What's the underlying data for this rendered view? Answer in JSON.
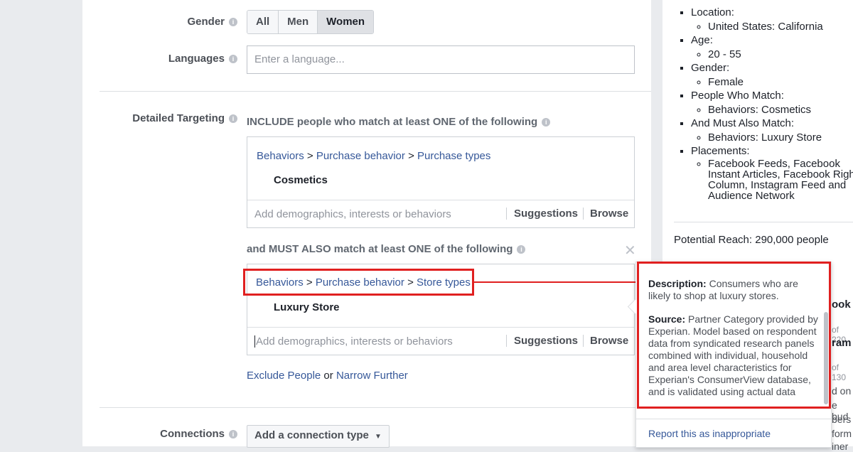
{
  "gender": {
    "label": "Gender",
    "options": [
      "All",
      "Men",
      "Women"
    ]
  },
  "languages": {
    "label": "Languages",
    "placeholder": "Enter a language..."
  },
  "detailed_targeting": {
    "label": "Detailed Targeting",
    "include_heading": "INCLUDE people who match at least ONE of the following",
    "include_crumbs": [
      "Behaviors",
      ">",
      "Purchase behavior",
      ">",
      "Purchase types"
    ],
    "include_item": "Cosmetics",
    "add_placeholder": "Add demographics, interests or behaviors",
    "suggestions": "Suggestions",
    "browse": "Browse",
    "must_heading": "and MUST ALSO match at least ONE of the following",
    "must_crumbs": [
      "Behaviors",
      ">",
      "Purchase behavior",
      ">",
      "Store types"
    ],
    "must_item": "Luxury Store",
    "exclude": "Exclude People",
    "or": "or",
    "narrow": "Narrow Further"
  },
  "connections": {
    "label": "Connections",
    "button": "Add a connection type"
  },
  "summary": {
    "location_label": "Location:",
    "location_value": "United States: California",
    "age_label": "Age:",
    "age_value": "20 - 55",
    "gender_label": "Gender:",
    "gender_value": "Female",
    "match_label": "People Who Match:",
    "match_value": "Behaviors: Cosmetics",
    "also_label": "And Must Also Match:",
    "also_value": "Behaviors: Luxury Store",
    "placements_label": "Placements:",
    "placements_value": "Facebook Feeds, Facebook Instant Articles, Facebook Right Column, Instagram Feed and Audience Network",
    "reach": "Potential Reach: 290,000 people"
  },
  "tooltip": {
    "desc_label": "Description:",
    "desc_text": "Consumers who are likely to shop at luxury stores.",
    "source_label": "Source:",
    "source_text": "Partner Category provided by Experian. Model based on respondent data from syndicated research panels combined with individual, household and area level characteristics for Experian's ConsumerView database, and is validated using actual data",
    "report": "Report this as inappropriate"
  },
  "peek": [
    "ook",
    "of 220",
    "ram",
    "of 130",
    "d on",
    "e bud",
    "bers",
    "form",
    "iner"
  ]
}
